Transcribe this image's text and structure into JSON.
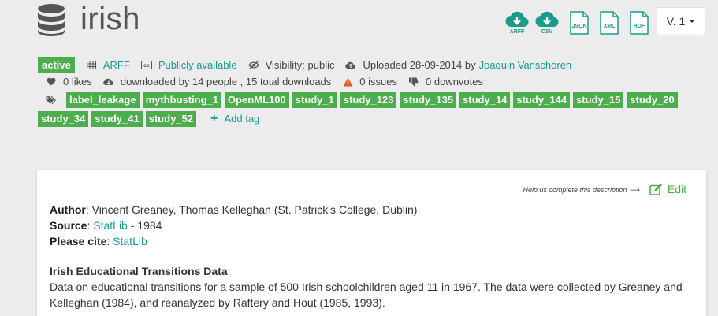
{
  "dataset": {
    "title": "irish"
  },
  "downloads": [
    {
      "label": "ARFF"
    },
    {
      "label": "CSV"
    }
  ],
  "docs": [
    {
      "label": "JSON"
    },
    {
      "label": "XML"
    },
    {
      "label": "RDF"
    }
  ],
  "version": {
    "label": "V. 1"
  },
  "meta": {
    "status": "active",
    "format": "ARFF",
    "license": "Publicly available",
    "visibility": "Visibility: public",
    "uploaded_prefix": "Uploaded 28-09-2014 by",
    "uploader": "Joaquin Vanschoren",
    "likes": "0 likes",
    "downloaded": "downloaded by 14 people , 15 total downloads",
    "issues": "0 issues",
    "downvotes": "0 downvotes"
  },
  "tags": [
    "label_leakage",
    "mythbusting_1",
    "OpenML100",
    "study_1",
    "study_123",
    "study_135",
    "study_14",
    "study_144",
    "study_15",
    "study_20",
    "study_34",
    "study_41",
    "study_52"
  ],
  "add_tag_label": "Add tag",
  "description": {
    "help_text": "Help us complete this description",
    "edit_label": "Edit",
    "author_label": "Author",
    "author_value": ": Vincent Greaney, Thomas Kelleghan (St. Patrick's College, Dublin)",
    "source_label": "Source",
    "source_link": "StatLib",
    "source_suffix": " - 1984",
    "cite_label": "Please cite",
    "cite_link": "StatLib",
    "section_title": "Irish Educational Transitions Data",
    "paragraph": "Data on educational transitions for a sample of 500 Irish schoolchildren aged 11 in 1967. The data were collected by Greaney and Kelleghan (1984), and reanalyzed by Raftery and Hout (1985, 1993)."
  },
  "colors": {
    "accent": "#1a9b8c",
    "green": "#4cae4c",
    "warning": "#e8541c"
  }
}
